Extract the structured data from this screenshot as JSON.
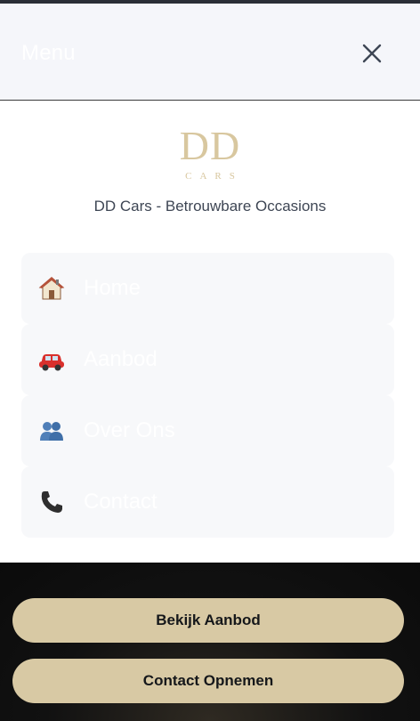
{
  "header": {
    "title": "Menu",
    "close_icon": "close-icon"
  },
  "brand": {
    "logo_mark": "DD",
    "logo_sub": "CARS",
    "tagline": "DD Cars - Betrouwbare Occasions",
    "accent_color": "#d8c79f"
  },
  "menu": {
    "items": [
      {
        "label": "Home",
        "icon": "house-icon"
      },
      {
        "label": "Aanbod",
        "icon": "car-icon"
      },
      {
        "label": "Over Ons",
        "icon": "people-icon"
      },
      {
        "label": "Contact",
        "icon": "phone-icon"
      }
    ]
  },
  "actions": {
    "view_inventory_label": "Bekijk Aanbod",
    "contact_label": "Contact Opnemen",
    "button_color": "#d8c9a4"
  }
}
